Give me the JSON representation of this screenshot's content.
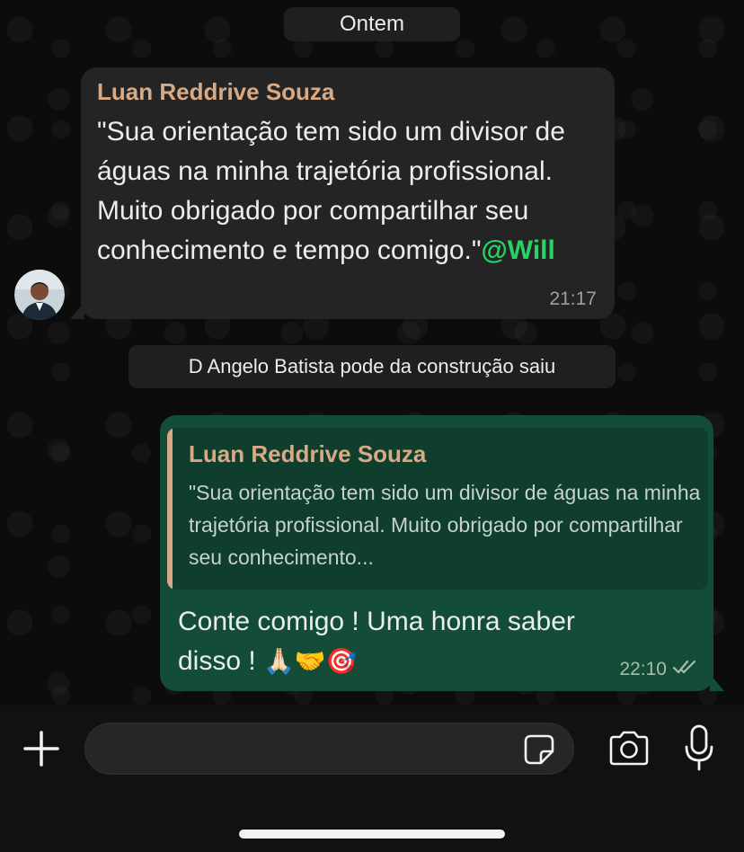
{
  "date_separator": "Ontem",
  "messages": {
    "incoming": {
      "sender": "Luan Reddrive Souza",
      "text": "\"Sua orientação tem sido um divisor de águas na minha trajetória profissional. Muito obrigado por compartilhar seu conhecimento e tempo comigo.\"",
      "mention": "@Will",
      "time": "21:17"
    },
    "system_notice": "D Angelo Batista pode da construção saiu",
    "outgoing": {
      "quoted_sender": "Luan Reddrive Souza",
      "quoted_text": "\"Sua orientação tem sido um divisor de águas na minha trajetória profissional. Muito obrigado por compartilhar seu conhecimento...",
      "text": "Conte comigo ! Uma honra saber disso !",
      "emojis": "🙏🏻🤝🎯",
      "time": "22:10",
      "status": "read"
    }
  },
  "input_bar": {
    "placeholder": "",
    "icons": [
      "plus-icon",
      "sticker-icon",
      "camera-icon",
      "microphone-icon"
    ]
  },
  "colors": {
    "sender_name": "#d8a985",
    "mention": "#25d366",
    "outgoing_bubble": "#134d37",
    "incoming_bubble": "#242424"
  }
}
